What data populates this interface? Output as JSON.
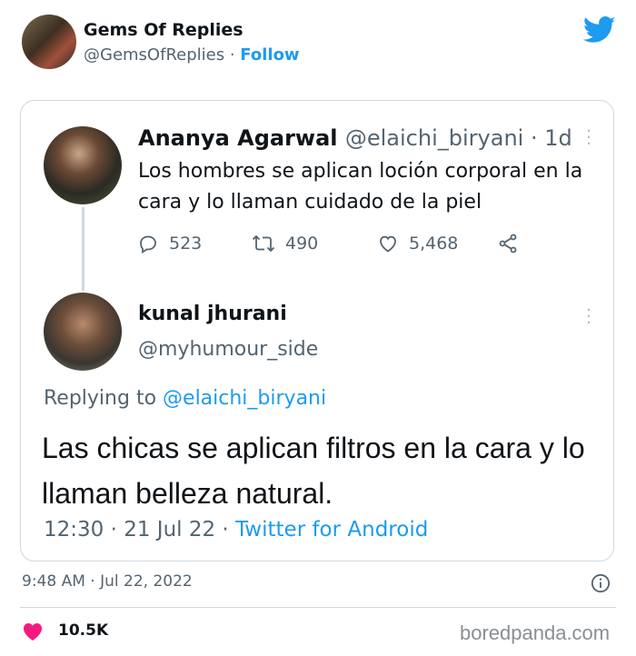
{
  "outer": {
    "name": "Gems Of Replies",
    "handle": "@GemsOfReplies",
    "separator": "·",
    "follow": "Follow",
    "timestamp": "9:48 AM · Jul 22, 2022",
    "likes": "10.5K",
    "watermark": "boredpanda.com"
  },
  "quoted": {
    "author": "Ananya Agarwal",
    "handle_time": "@elaichi_biryani · 1d",
    "text": "Los hombres se aplican loción corporal en la cara y lo llaman cuidado de la piel",
    "replies": "523",
    "retweets": "490",
    "likes": "5,468"
  },
  "reply": {
    "author": "kunal jhurani",
    "handle": "@myhumour_side",
    "replying_prefix": "Replying to",
    "replying_to": "@elaichi_biryani",
    "text": "Las chicas se aplican filtros en la cara y lo llaman belleza natural.",
    "time_date": "12:30 · 21 Jul 22 ·",
    "source": "Twitter for Android"
  },
  "colors": {
    "accent": "#1d9bf0",
    "muted": "#536471",
    "heart": "#f91880"
  }
}
